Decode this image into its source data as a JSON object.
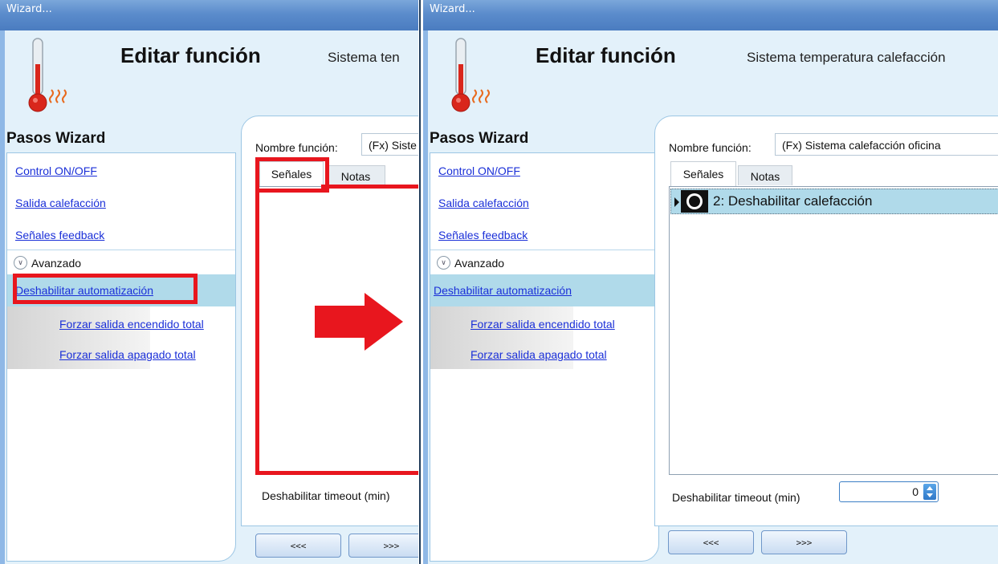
{
  "left": {
    "window_title": "Wizard...",
    "heading": "Editar función",
    "subtitle": "Sistema ten",
    "steps_title": "Pasos Wizard",
    "steps": {
      "control": "Control ON/OFF",
      "salida": "Salida calefacción",
      "feedback": "Señales feedback",
      "advanced": "Avanzado",
      "deshabilitar": "Deshabilitar automatización",
      "forzar_encendido": "Forzar salida encendido total",
      "forzar_apagado": "Forzar salida apagado total"
    },
    "name_label": "Nombre función:",
    "name_value": "(Fx) Siste",
    "tab_signals": "Señales",
    "tab_notes": "Notas",
    "timeout_label": "Deshabilitar timeout (min)",
    "prev": "<<<",
    "next": ">>>"
  },
  "right": {
    "window_title": "Wizard...",
    "heading": "Editar función",
    "subtitle": "Sistema temperatura calefacción",
    "steps_title": "Pasos Wizard",
    "steps": {
      "control": "Control ON/OFF",
      "salida": "Salida calefacción",
      "feedback": "Señales feedback",
      "advanced": "Avanzado",
      "deshabilitar": "Deshabilitar automatización",
      "forzar_encendido": "Forzar salida encendido total",
      "forzar_apagado": "Forzar salida apagado total"
    },
    "name_label": "Nombre función:",
    "name_value": "(Fx) Sistema calefacción oficina",
    "tab_signals": "Señales",
    "tab_notes": "Notas",
    "signal_row": "2: Deshabilitar calefacción",
    "timeout_label": "Deshabilitar timeout (min)",
    "timeout_value": "0",
    "prev": "<<<",
    "next": ">>>"
  },
  "colors": {
    "highlight_red": "#e8161e",
    "selected_row": "#b0daea",
    "link": "#1a2fd8"
  },
  "icons": [
    "thermometer-icon",
    "arrow-right-icon",
    "signal-icon",
    "chevron-down-icon"
  ]
}
